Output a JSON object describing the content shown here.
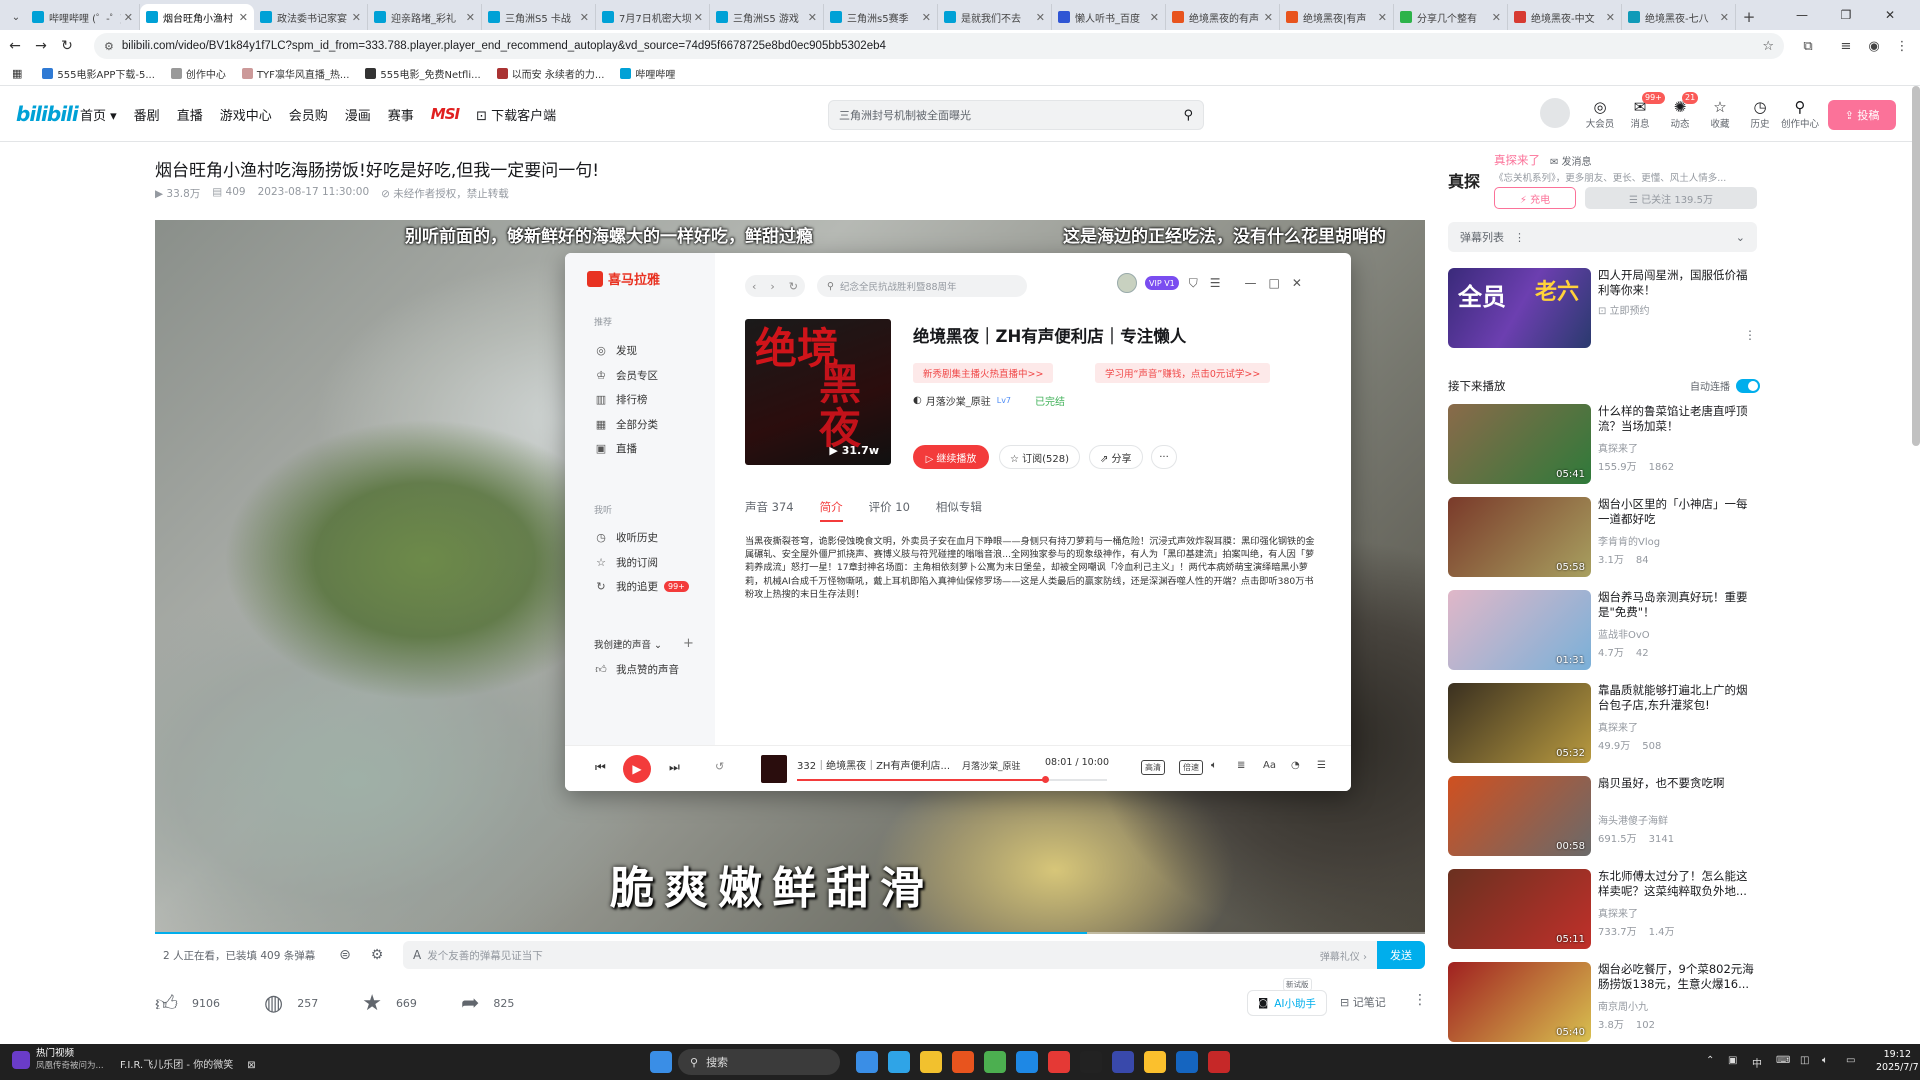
{
  "browser": {
    "tabs": [
      {
        "label": "哔哩哔哩 (゜-゜)つロ",
        "color": "#00a1d6"
      },
      {
        "label": "烟台旺角小渔村",
        "color": "#00a1d6",
        "active": true
      },
      {
        "label": "政法委书记家宴",
        "color": "#00a1d6"
      },
      {
        "label": "迎亲路堵_彩礼",
        "color": "#00a1d6"
      },
      {
        "label": "三角洲S5 卡战",
        "color": "#00a1d6"
      },
      {
        "label": "7月7日机密大坝",
        "color": "#00a1d6"
      },
      {
        "label": "三角洲S5 游戏",
        "color": "#00a1d6"
      },
      {
        "label": "三角洲s5赛季",
        "color": "#00a1d6"
      },
      {
        "label": "是就我们不去",
        "color": "#00a1d6"
      },
      {
        "label": "懒人听书_百度",
        "color": "#2f55d4"
      },
      {
        "label": "绝境黑夜的有声",
        "color": "#e8541e"
      },
      {
        "label": "绝境黑夜|有声",
        "color": "#e8541e"
      },
      {
        "label": "分享几个整有",
        "color": "#2db34a"
      },
      {
        "label": "绝境黑夜-中文",
        "color": "#d73a31"
      },
      {
        "label": "绝境黑夜-七八",
        "color": "#0f9ab8"
      }
    ],
    "new_tab": "+",
    "url": "bilibili.com/video/BV1k84y1f7LC?spm_id_from=333.788.player.player_end_recommend_autoplay&vd_source=74d95f6678725e8bd0ec905bb5302eb4",
    "bookmarks": [
      "555电影APP下载-5...",
      "创作中心",
      "TYF凛华风直播_热...",
      "555电影_免费Netfli...",
      "以而安 永续者的力...",
      "哔哩哔哩"
    ]
  },
  "bili": {
    "logo": "bilibili",
    "nav": [
      "首页 ▾",
      "番剧",
      "直播",
      "游戏中心",
      "会员购",
      "漫画",
      "赛事",
      "MSI",
      "⊡ 下载客户端"
    ],
    "search_placeholder": "三角洲封号机制被全面曝光",
    "header_icons": [
      {
        "label": "大会员",
        "glyph": "◎",
        "badge": ""
      },
      {
        "label": "消息",
        "glyph": "✉",
        "badge": "99+"
      },
      {
        "label": "动态",
        "glyph": "✺",
        "badge": "21"
      },
      {
        "label": "收藏",
        "glyph": "☆",
        "badge": ""
      },
      {
        "label": "历史",
        "glyph": "◷",
        "badge": ""
      },
      {
        "label": "创作中心",
        "glyph": "⚲",
        "badge": ""
      }
    ],
    "upload_label": "⇪ 投稿"
  },
  "video": {
    "title": "烟台旺角小渔村吃海肠捞饭!好吃是好吃,但我一定要问一句!",
    "views": "▶ 33.8万",
    "danmaku": "▤ 409",
    "date": "2023-08-17 11:30:00",
    "copyright": "⊘ 未经作者授权，禁止转载",
    "sub_left": "别听前面的，够新鲜好的海螺大的一样好吃，鲜甜过瘾",
    "sub_right": "这是海边的正经吃法，没有什么花里胡哨的",
    "sub_big": "脆爽嫩鲜甜滑",
    "progress": 0.734,
    "watching": "2 人正在看，已装填 409 条弹幕",
    "danmu_placeholder": "发个友善的弹幕见证当下",
    "danmu_etiquette": "弹幕礼仪 ›",
    "send": "发送",
    "like": "9106",
    "coin": "257",
    "fav": "669",
    "share": "825",
    "ai_tag": "新试版",
    "ai_label": "AI小助手",
    "notes_label": "⊟ 记笔记"
  },
  "xmly": {
    "logo": "喜马拉雅",
    "sec_recommend": "推荐",
    "menu": [
      {
        "icon": "◎",
        "label": "发现"
      },
      {
        "icon": "♔",
        "label": "会员专区"
      },
      {
        "icon": "▥",
        "label": "排行榜"
      },
      {
        "icon": "▦",
        "label": "全部分类"
      },
      {
        "icon": "▣",
        "label": "直播"
      }
    ],
    "sec_mine": "我听",
    "mine": [
      {
        "icon": "◷",
        "label": "收听历史",
        "badge": ""
      },
      {
        "icon": "☆",
        "label": "我的订阅",
        "badge": ""
      },
      {
        "icon": "↻",
        "label": "我的追更",
        "badge": "99+"
      }
    ],
    "sec_created": "我创建的声音 ⌄",
    "liked": "我点赞的声音",
    "search_placeholder": "纪念全民抗战胜利暨88周年",
    "vip": "VIP V1",
    "cover_text1": "绝境",
    "cover_text2": "黑夜",
    "cover_plays": "▶ 31.7w",
    "album_title": "绝境黑夜｜ZH有声便利店｜专注懒人",
    "pill1": "新秀剧集主播火热直播中>>",
    "pill2": "学习用“声音”赚钱，点击0元试学>>",
    "author": "月落沙棠_原驻",
    "author_level": "Lv7",
    "finished": "已完结",
    "btn_play": "▷ 继续播放",
    "btn_sub": "☆ 订阅(528)",
    "btn_share": "⇗ 分享",
    "btn_more": "···",
    "tabs": [
      "声音 374",
      "简介",
      "评价 10",
      "相似专辑"
    ],
    "description": "当黑夜撕裂苍穹，诡影侵蚀晚食文明，外卖员子安在血月下睁眼——身侧只有持刀萝莉与一桶危险！沉浸式声效炸裂耳膜：黑印强化钢铁的金属碾轧、安全屋外僵尸抓挠声、赛博义肢与符咒碰撞的嗡嗡音浪...全网独家参与的现象级神作，有人为「黑印基建流」拍案叫绝，有人因「萝莉养成流」怒打一星！17章封神名场面：主角相依刻萝卜公寓为末日堡垒，却被全网嘲讽「冷血利己主义」！两代本病娇萌宝演绎暗黑小萝莉，机械AI合成千万怪物嘶吼，戴上耳机即陷入真神仙保修罗场——这是人类最后的赢家防线，还是深渊吞噬人性的开端？点击即听380万书粉攻上热搜的末日生存法则！",
    "now_playing": "332｜绝境黑夜｜ZH有声便利店...",
    "now_author": "月落沙棠_原驻",
    "time": "08:01 / 10:00",
    "play_progress": 0.8,
    "quality": "高清",
    "speed": "倍速"
  },
  "sidebar": {
    "up_name": "真探来了",
    "up_msg": "✉ 发消息",
    "up_desc": "《忘关机系列》，更多朋友、更长、更懂、风土人情多...",
    "up_avatar_text": "真探",
    "charge": "⚡ 充电",
    "follow": "☰ 已关注 139.5万",
    "danmu_list": "弹幕列表",
    "ad_title": "四人开局闯星洲，国服低价福利等你来！",
    "ad_sub": "⊡ 立即预约",
    "ad_img1": "全员",
    "ad_img2": "老六",
    "next_label": "接下来播放",
    "autoplay": "自动连播",
    "recs": [
      {
        "title": "什么样的鲁菜馅让老唐直呼顶流？当场加菜！",
        "author": "真探来了",
        "views": "155.9万",
        "dm": "1862",
        "dur": "05:41",
        "c1": "#8a6a4a",
        "c2": "#2f7a3a"
      },
      {
        "title": "烟台小区里的「小神店」一每一道都好吃",
        "author": "李肯肯的Vlog",
        "views": "3.1万",
        "dm": "84",
        "dur": "05:58",
        "c1": "#7a3a2a",
        "c2": "#a8a060"
      },
      {
        "title": "烟台养马岛亲测真好玩！重要是\"免费\"！",
        "author": "蓝战非OvO",
        "views": "4.7万",
        "dm": "42",
        "dur": "01:31",
        "c1": "#e0b7c8",
        "c2": "#7ab0d8"
      },
      {
        "title": "靠晶质就能够打遍北上广的烟台包子店,东升灌浆包!",
        "author": "真探来了",
        "views": "49.9万",
        "dm": "508",
        "dur": "05:32",
        "c1": "#3a3020",
        "c2": "#b89a40"
      },
      {
        "title": "扇贝虽好，也不要贪吃啊",
        "author": "海头港傻子海鲜",
        "views": "691.5万",
        "dm": "3141",
        "dur": "00:58",
        "c1": "#d05020",
        "c2": "#6a6a6a"
      },
      {
        "title": "东北师傅太过分了！怎么能这样卖呢？这菜纯粹取负外地...",
        "author": "真探来了",
        "views": "733.7万",
        "dm": "1.4万",
        "dur": "05:11",
        "c1": "#6a3020",
        "c2": "#c0302a"
      },
      {
        "title": "烟台必吃餐厅，9个菜802元海肠捞饭138元，生意火爆16...",
        "author": "南京周小九",
        "views": "3.8万",
        "dm": "102",
        "dur": "05:40",
        "c1": "#a02020",
        "c2": "#d8c050"
      }
    ]
  },
  "taskbar": {
    "news_title": "热门视频",
    "news_sub": "凤凰传奇被问为...",
    "media": "F.I.R.飞儿乐团 - 你的微笑",
    "search": "搜索",
    "time": "19:12",
    "date": "2025/7/7",
    "ime": "中",
    "app_colors": [
      "#3a8ee6",
      "#2fa4e7",
      "#f2c12e",
      "#e8541e",
      "#4caf50",
      "#1e88e5",
      "#e53935",
      "#222222",
      "#3949ab",
      "#fbc02d",
      "#1565c0",
      "#c62828"
    ]
  }
}
